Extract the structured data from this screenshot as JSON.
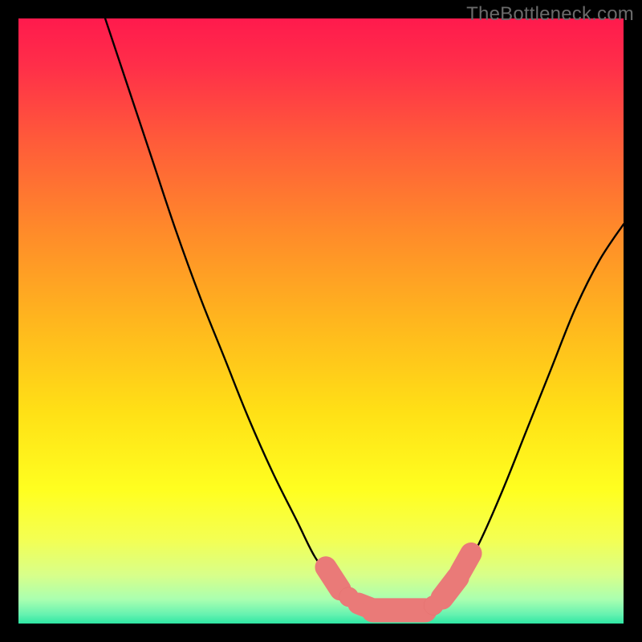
{
  "watermark": "TheBottleneck.com",
  "colors": {
    "bg": "#000000",
    "curve": "#000000",
    "marker_fill": "#ea7a78",
    "marker_stroke": "#e46f6d",
    "gradient_stops": [
      {
        "offset": 0.0,
        "color": "#ff1a4d"
      },
      {
        "offset": 0.08,
        "color": "#ff2f49"
      },
      {
        "offset": 0.2,
        "color": "#ff5a3a"
      },
      {
        "offset": 0.35,
        "color": "#ff8a2a"
      },
      {
        "offset": 0.5,
        "color": "#ffb61e"
      },
      {
        "offset": 0.65,
        "color": "#ffe016"
      },
      {
        "offset": 0.78,
        "color": "#ffff20"
      },
      {
        "offset": 0.86,
        "color": "#f4ff52"
      },
      {
        "offset": 0.92,
        "color": "#d8ff8a"
      },
      {
        "offset": 0.96,
        "color": "#aaffb0"
      },
      {
        "offset": 0.985,
        "color": "#66f2b0"
      },
      {
        "offset": 1.0,
        "color": "#2fe6a3"
      }
    ]
  },
  "chart_data": {
    "type": "line",
    "title": "",
    "xlabel": "",
    "ylabel": "",
    "xlim": [
      0,
      100
    ],
    "ylim": [
      0,
      100
    ],
    "grid": false,
    "legend": false,
    "series": [
      {
        "name": "left-branch",
        "x": [
          14,
          18,
          22,
          26,
          30,
          34,
          38,
          42,
          46,
          49,
          52,
          55,
          57,
          58.5
        ],
        "y": [
          101,
          89,
          77,
          65,
          54,
          44,
          34,
          25,
          17,
          11,
          7,
          4,
          2.5,
          2
        ]
      },
      {
        "name": "valley-floor",
        "x": [
          58.5,
          60,
          62,
          64,
          66,
          67.5,
          69
        ],
        "y": [
          2,
          1.9,
          1.8,
          1.8,
          2.0,
          2.3,
          2.8
        ]
      },
      {
        "name": "right-branch",
        "x": [
          69,
          72,
          76,
          80,
          84,
          88,
          92,
          96,
          100
        ],
        "y": [
          2.8,
          6,
          13,
          22,
          32,
          42,
          52,
          60,
          66
        ]
      }
    ],
    "markers": [
      {
        "shape": "capsule",
        "x1": 50.8,
        "y1": 9.3,
        "x2": 53.2,
        "y2": 5.6,
        "r": 1.8
      },
      {
        "shape": "dot",
        "cx": 54.6,
        "cy": 4.4,
        "r": 1.6
      },
      {
        "shape": "capsule",
        "x1": 56.2,
        "y1": 3.3,
        "x2": 58.0,
        "y2": 2.6,
        "r": 1.8
      },
      {
        "shape": "capsule",
        "x1": 58.6,
        "y1": 2.2,
        "x2": 67.2,
        "y2": 2.2,
        "r": 2.0
      },
      {
        "shape": "dot",
        "cx": 68.6,
        "cy": 3.0,
        "r": 1.6
      },
      {
        "shape": "capsule",
        "x1": 70.0,
        "y1": 4.2,
        "x2": 72.6,
        "y2": 7.6,
        "r": 1.9
      },
      {
        "shape": "capsule",
        "x1": 73.0,
        "y1": 8.4,
        "x2": 74.8,
        "y2": 11.6,
        "r": 1.8
      }
    ]
  }
}
